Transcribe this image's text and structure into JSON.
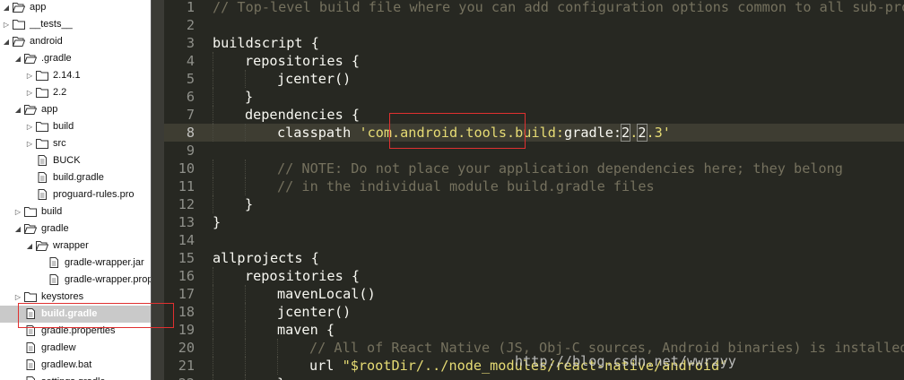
{
  "file_tree": [
    {
      "label": "app",
      "depth": 0,
      "state": "open",
      "kind": "folder"
    },
    {
      "label": "__tests__",
      "depth": 0,
      "state": "closed",
      "kind": "folder"
    },
    {
      "label": "android",
      "depth": 0,
      "state": "open",
      "kind": "folder"
    },
    {
      "label": ".gradle",
      "depth": 1,
      "state": "open",
      "kind": "folder"
    },
    {
      "label": "2.14.1",
      "depth": 2,
      "state": "closed",
      "kind": "folder"
    },
    {
      "label": "2.2",
      "depth": 2,
      "state": "closed",
      "kind": "folder"
    },
    {
      "label": "app",
      "depth": 1,
      "state": "open",
      "kind": "folder"
    },
    {
      "label": "build",
      "depth": 2,
      "state": "closed",
      "kind": "folder"
    },
    {
      "label": "src",
      "depth": 2,
      "state": "closed",
      "kind": "folder"
    },
    {
      "label": "BUCK",
      "depth": 2,
      "state": "none",
      "kind": "file"
    },
    {
      "label": "build.gradle",
      "depth": 2,
      "state": "none",
      "kind": "file"
    },
    {
      "label": "proguard-rules.pro",
      "depth": 2,
      "state": "none",
      "kind": "file"
    },
    {
      "label": "build",
      "depth": 1,
      "state": "closed",
      "kind": "folder"
    },
    {
      "label": "gradle",
      "depth": 1,
      "state": "open",
      "kind": "folder"
    },
    {
      "label": "wrapper",
      "depth": 2,
      "state": "open",
      "kind": "folder"
    },
    {
      "label": "gradle-wrapper.jar",
      "depth": 3,
      "state": "none",
      "kind": "file"
    },
    {
      "label": "gradle-wrapper.properties",
      "depth": 3,
      "state": "none",
      "kind": "file"
    },
    {
      "label": "keystores",
      "depth": 1,
      "state": "closed",
      "kind": "folder"
    },
    {
      "label": "build.gradle",
      "depth": 1,
      "state": "none",
      "kind": "file",
      "selected": true
    },
    {
      "label": "gradle.properties",
      "depth": 1,
      "state": "none",
      "kind": "file"
    },
    {
      "label": "gradlew",
      "depth": 1,
      "state": "none",
      "kind": "file"
    },
    {
      "label": "gradlew.bat",
      "depth": 1,
      "state": "none",
      "kind": "file"
    },
    {
      "label": "settings.gradle",
      "depth": 1,
      "state": "none",
      "kind": "file"
    }
  ],
  "editor": {
    "current_line": 8,
    "lines": [
      {
        "n": "1",
        "indent": 0,
        "parts": [
          {
            "t": "// Top-level build file where you can add configuration options common to all sub-projects/modules.",
            "c": "comment"
          }
        ]
      },
      {
        "n": "2",
        "indent": 0,
        "parts": []
      },
      {
        "n": "3",
        "indent": 0,
        "parts": [
          {
            "t": "buildscript {",
            "c": "plain"
          }
        ]
      },
      {
        "n": "4",
        "indent": 1,
        "parts": [
          {
            "t": "repositories {",
            "c": "plain"
          }
        ]
      },
      {
        "n": "5",
        "indent": 2,
        "parts": [
          {
            "t": "jcenter()",
            "c": "plain"
          }
        ]
      },
      {
        "n": "6",
        "indent": 1,
        "parts": [
          {
            "t": "}",
            "c": "plain"
          }
        ]
      },
      {
        "n": "7",
        "indent": 1,
        "parts": [
          {
            "t": "dependencies {",
            "c": "plain"
          }
        ]
      },
      {
        "n": "8",
        "indent": 2,
        "parts": [
          {
            "t": "classpath ",
            "c": "plain"
          },
          {
            "t": "'com.android.tools.build:",
            "c": "str"
          },
          {
            "t": "gradle:",
            "c": "plain"
          },
          {
            "t": "2",
            "c": "hl"
          },
          {
            "t": ".",
            "c": "str"
          },
          {
            "t": "2",
            "c": "hl"
          },
          {
            "t": ".3'",
            "c": "str"
          }
        ]
      },
      {
        "n": "9",
        "indent": 0,
        "parts": []
      },
      {
        "n": "10",
        "indent": 2,
        "parts": [
          {
            "t": "// NOTE: Do not place your application dependencies here; they belong",
            "c": "comment"
          }
        ]
      },
      {
        "n": "11",
        "indent": 2,
        "parts": [
          {
            "t": "// in the individual module build.gradle files",
            "c": "comment"
          }
        ]
      },
      {
        "n": "12",
        "indent": 1,
        "parts": [
          {
            "t": "}",
            "c": "plain"
          }
        ]
      },
      {
        "n": "13",
        "indent": 0,
        "parts": [
          {
            "t": "}",
            "c": "plain"
          }
        ]
      },
      {
        "n": "14",
        "indent": 0,
        "parts": []
      },
      {
        "n": "15",
        "indent": 0,
        "parts": [
          {
            "t": "allprojects {",
            "c": "plain"
          }
        ]
      },
      {
        "n": "16",
        "indent": 1,
        "parts": [
          {
            "t": "repositories {",
            "c": "plain"
          }
        ]
      },
      {
        "n": "17",
        "indent": 2,
        "parts": [
          {
            "t": "mavenLocal()",
            "c": "plain"
          }
        ]
      },
      {
        "n": "18",
        "indent": 2,
        "parts": [
          {
            "t": "jcenter()",
            "c": "plain"
          }
        ]
      },
      {
        "n": "19",
        "indent": 2,
        "parts": [
          {
            "t": "maven {",
            "c": "plain"
          }
        ]
      },
      {
        "n": "20",
        "indent": 3,
        "parts": [
          {
            "t": "// All of React Native (JS, Obj-C sources, Android binaries) is installed from npm",
            "c": "comment"
          }
        ]
      },
      {
        "n": "21",
        "indent": 3,
        "parts": [
          {
            "t": "url ",
            "c": "plain"
          },
          {
            "t": "\"$rootDir/../node_modules/react-native/android\"",
            "c": "str"
          }
        ]
      },
      {
        "n": "22",
        "indent": 2,
        "parts": [
          {
            "t": "}",
            "c": "plain"
          }
        ]
      }
    ]
  },
  "watermark": "http://blog.csdn.net/wwrzyy",
  "colors": {
    "editor_bg": "#272822",
    "comment": "#75715e",
    "string": "#e6db74",
    "text": "#f8f8f2",
    "annotation_box": "#e03030"
  }
}
